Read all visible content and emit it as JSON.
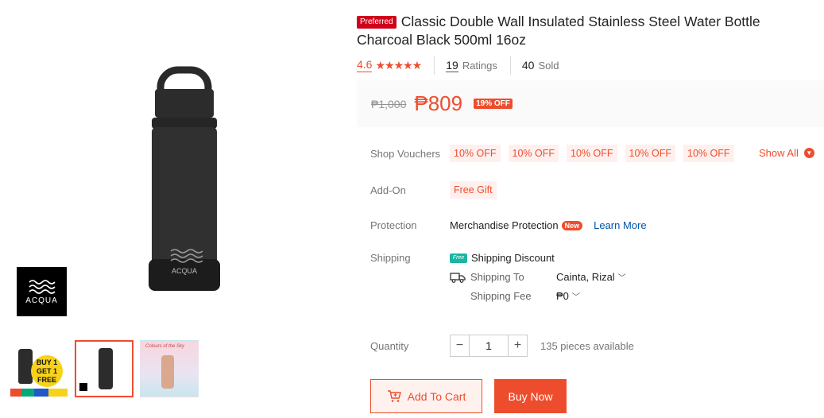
{
  "product": {
    "preferred_badge": "Preferred",
    "title": "Classic Double Wall Insulated Stainless Steel Water Bottle Charcoal Black 500ml 16oz",
    "rating": "4.6",
    "stars": "★★★★★",
    "ratings_count": "19",
    "ratings_label": "Ratings",
    "sold_count": "40",
    "sold_label": "Sold",
    "brand_logo_text": "ACQUA"
  },
  "price": {
    "original": "₱1,000",
    "current": "₱809",
    "discount": "19% OFF"
  },
  "vouchers": {
    "label": "Shop Vouchers",
    "items": [
      "10% OFF",
      "10% OFF",
      "10% OFF",
      "10% OFF",
      "10% OFF"
    ],
    "show_all": "Show All"
  },
  "addon": {
    "label": "Add-On",
    "value": "Free Gift"
  },
  "protection": {
    "label": "Protection",
    "value": "Merchandise Protection",
    "badge": "New",
    "link": "Learn More"
  },
  "shipping": {
    "label": "Shipping",
    "free_icon_text": "Free",
    "discount_text": "Shipping Discount",
    "to_label": "Shipping To",
    "to_value": "Cainta, Rizal",
    "fee_label": "Shipping Fee",
    "fee_value": "₱0"
  },
  "quantity": {
    "label": "Quantity",
    "value": "1",
    "available": "135 pieces available"
  },
  "actions": {
    "add_to_cart": "Add To Cart",
    "buy_now": "Buy Now"
  },
  "thumbnails": [
    {
      "badge_text": "BUY 1 GET 1 FREE"
    },
    {
      "badge_text": ""
    },
    {
      "badge_text": "Colours of the Sky"
    }
  ],
  "colors": {
    "accent": "#ee4d2d",
    "link": "#0055aa",
    "preferred": "#d0011b"
  }
}
